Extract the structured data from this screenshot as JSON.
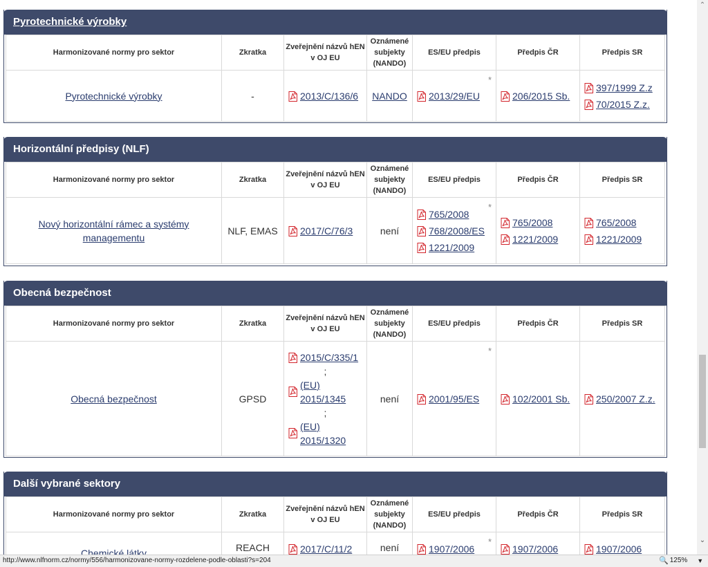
{
  "headers": {
    "norms": "Harmonizované normy pro sektor",
    "abbr": "Zkratka",
    "publ": "Zveřejnění názvů hEN v OJ EU",
    "nando": "Oznámené subjekty (NANDO)",
    "eu": "ES/EU předpis",
    "cz": "Předpis ČR",
    "sk": "Předpis SR"
  },
  "sections": [
    {
      "title": "Pyrotechnické výrobky",
      "row": {
        "name": "Pyrotechnické výrobky",
        "abbr": "-",
        "publ": [
          "2013/C/136/6"
        ],
        "nando": "NANDO",
        "eu": [
          "2013/29/EU"
        ],
        "cz": [
          "206/2015 Sb."
        ],
        "sk": [
          "397/1999 Z.z",
          "70/2015 Z.z."
        ]
      }
    },
    {
      "title": "Horizontální předpisy (NLF)",
      "row": {
        "name": "Nový horizontální rámec a systémy managementu",
        "abbr": "NLF, EMAS",
        "publ": [
          "2017/C/76/3"
        ],
        "nando": "není",
        "eu": [
          "765/2008",
          "768/2008/ES",
          "1221/2009"
        ],
        "cz": [
          "765/2008",
          "1221/2009"
        ],
        "sk": [
          "765/2008",
          "1221/2009"
        ]
      }
    },
    {
      "title": "Obecná bezpečnost",
      "row": {
        "name": "Obecná bezpečnost",
        "abbr": "GPSD",
        "publ": [
          "2015/C/335/1",
          "(EU) 2015/1345",
          "(EU) 2015/1320"
        ],
        "publ_sep": ";",
        "nando": "není",
        "eu": [
          "2001/95/ES"
        ],
        "cz": [
          "102/2001 Sb."
        ],
        "sk": [
          "250/2007 Z.z."
        ]
      }
    },
    {
      "title": "Další vybrané sektory",
      "row": {
        "name": "Chemické látky",
        "abbr": "REACH",
        "publ": [
          "2017/C/11/2"
        ],
        "nando": "není",
        "eu": [
          "1907/2006"
        ],
        "cz": [
          "1907/2006"
        ],
        "sk": [
          "1907/2006"
        ]
      }
    }
  ],
  "footnote_mark": "*",
  "status": {
    "url": "http://www.nlfnorm.cz/normy/556/harmonizovane-normy-rozdelene-podle-oblasti?s=204",
    "zoom": "125%"
  },
  "icons": {
    "pdf": "pdf-icon",
    "zoom": "magnifier-icon"
  },
  "colors": {
    "header_bg": "#3e4a6a",
    "link": "#2a3c6e",
    "pdf_red": "#d2232a"
  }
}
